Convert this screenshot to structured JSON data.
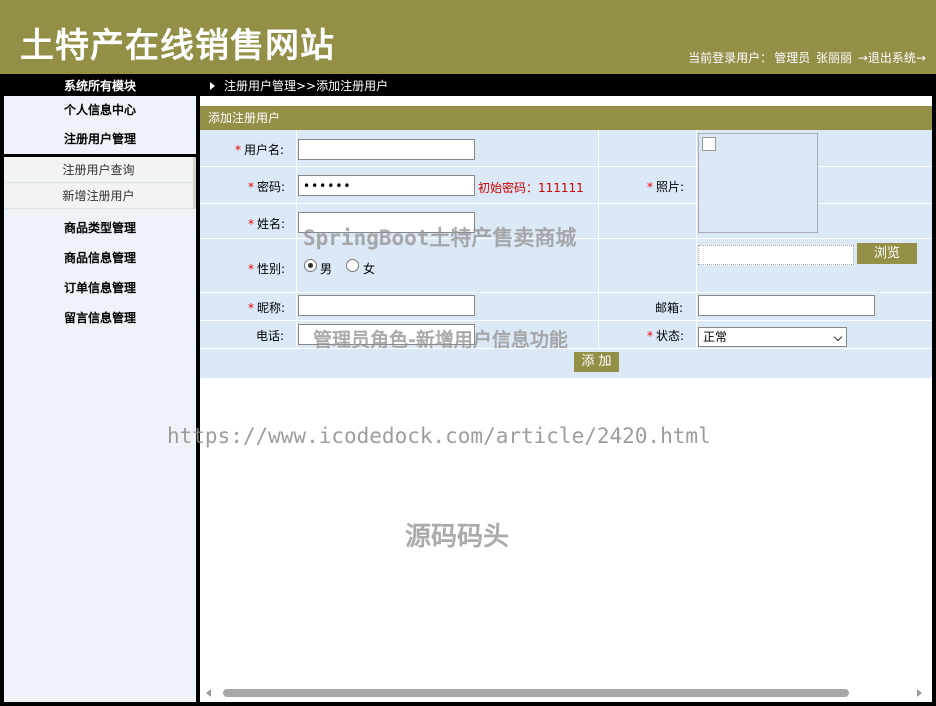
{
  "header": {
    "site_title": "土特产在线销售网站",
    "user_label": "当前登录用户：",
    "user_role": "管理员",
    "user_name": "张丽丽",
    "logout": "→退出系统→"
  },
  "topbar": {
    "module_title": "系统所有模块",
    "breadcrumb": "注册用户管理>>添加注册用户"
  },
  "sidebar": {
    "items": [
      {
        "label": "个人信息中心"
      },
      {
        "label": "注册用户管理"
      },
      {
        "label": "商品类型管理"
      },
      {
        "label": "商品信息管理"
      },
      {
        "label": "订单信息管理"
      },
      {
        "label": "留言信息管理"
      }
    ],
    "sub_items": [
      {
        "label": "注册用户查询"
      },
      {
        "label": "新增注册用户"
      }
    ]
  },
  "form": {
    "panel_title": "添加注册用户",
    "required_mark": "*",
    "username_label": "用户名:",
    "username_value": "",
    "password_label": "密码:",
    "password_value": "••••••",
    "password_hint": "初始密码：111111",
    "name_label": "姓名:",
    "name_value": "",
    "gender_label": "性别:",
    "gender_options": [
      "男",
      "女"
    ],
    "gender_selected": "男",
    "photo_label": "照片:",
    "browse_label": "浏览",
    "nickname_label": "昵称:",
    "nickname_value": "",
    "email_label": "邮箱:",
    "email_value": "",
    "phone_label": "电话:",
    "phone_value": "",
    "status_label": "状态:",
    "status_value": "正常",
    "submit_label": "添 加"
  },
  "watermarks": {
    "line1": "SpringBoot土特产售卖商城",
    "line2": "管理员角色-新增用户信息功能",
    "line3": "https://www.icodedock.com/article/2420.html",
    "line4": "源码码头"
  },
  "colors": {
    "accent": "#938f47",
    "form_bg": "#dbe8f6",
    "sidebar_bg": "#eef3fa",
    "required": "#e00000"
  }
}
